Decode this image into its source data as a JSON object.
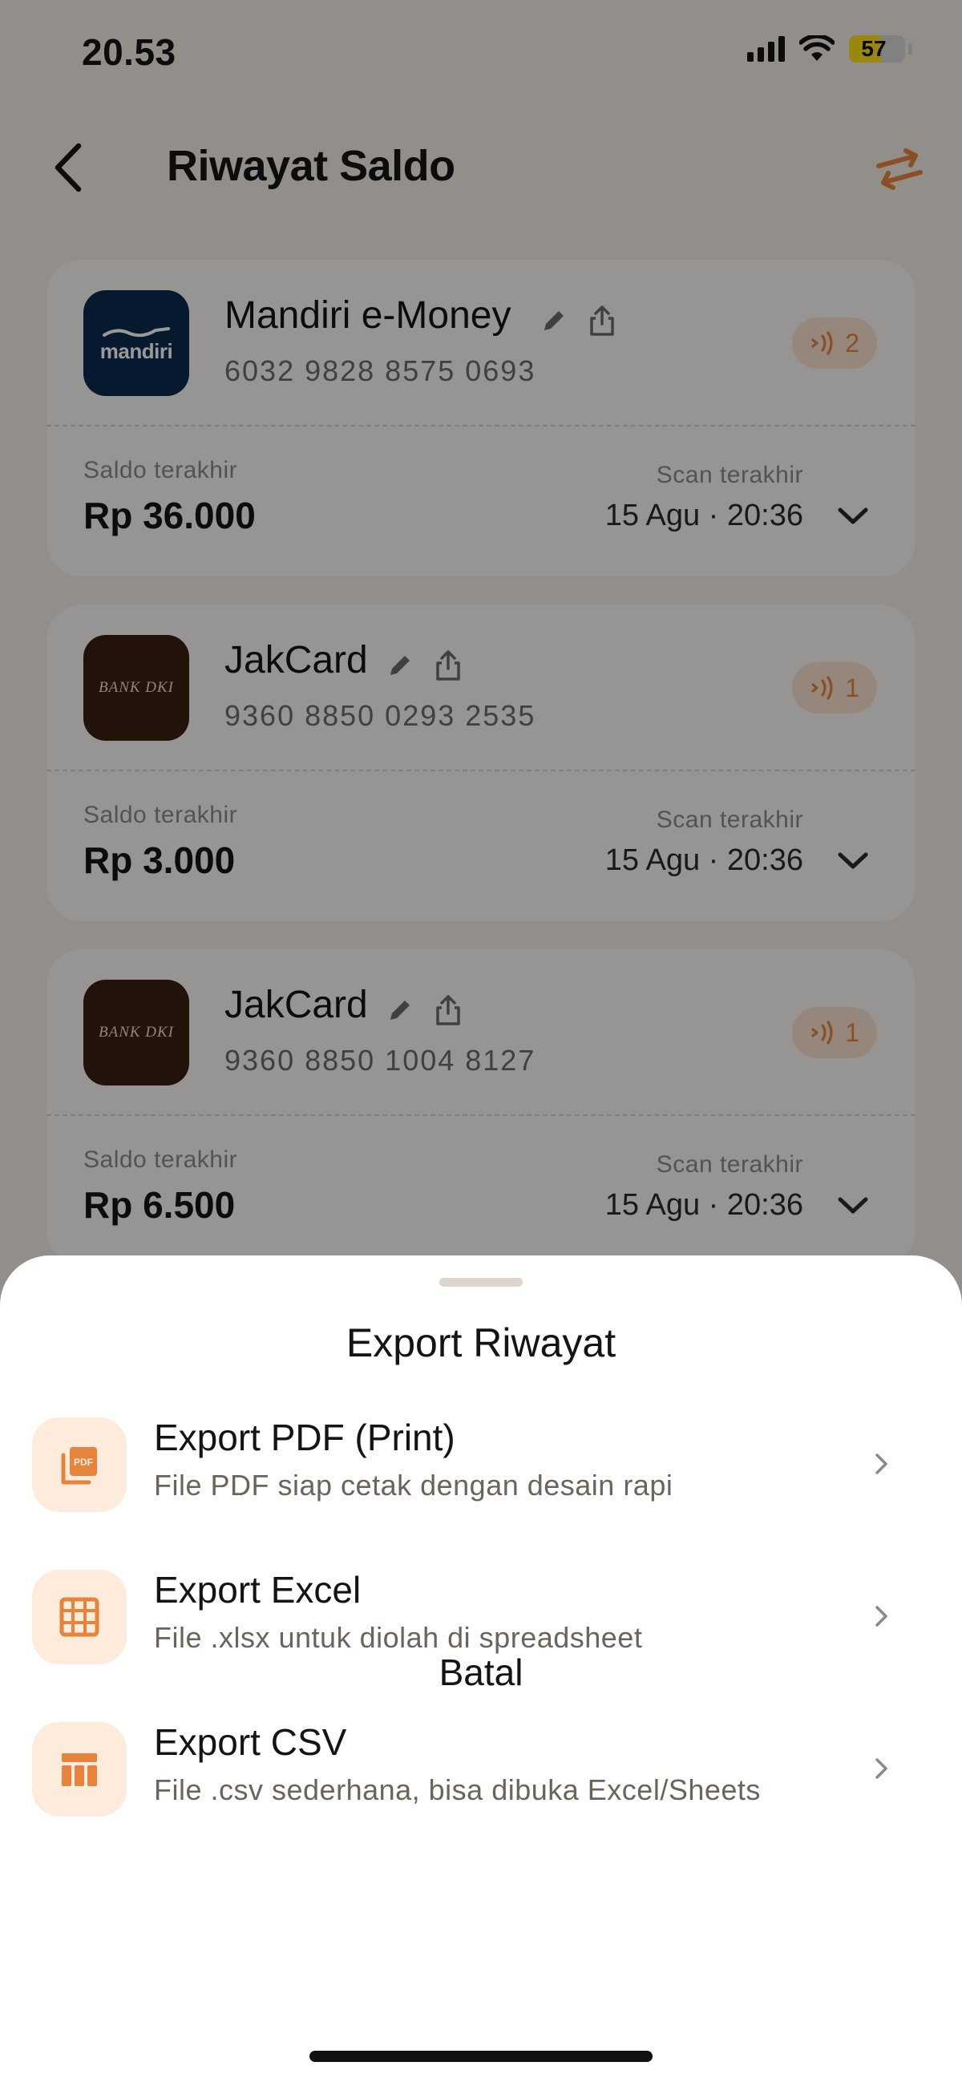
{
  "status_bar": {
    "time": "20.53",
    "battery": "57",
    "battery_level": 0.57,
    "icons": [
      "cellular-signal-icon",
      "wifi-icon",
      "battery-icon"
    ]
  },
  "header": {
    "title": "Riwayat Saldo",
    "back_icon": "chevron-left-icon",
    "action_icon": "swap-arrows-icon"
  },
  "cards": [
    {
      "name": "Mandiri e-Money",
      "number": "6032 9828 8575 0693",
      "logo_text": "mandiri",
      "scan_count": "2",
      "saldo_label": "Saldo terakhir",
      "saldo_value": "Rp 36.000",
      "scan_label": "Scan terakhir",
      "scan_value": "15 Agu · 20:36"
    },
    {
      "name": "JakCard",
      "number": "9360 8850 0293 2535",
      "logo_text": "BANK DKI",
      "scan_count": "1",
      "saldo_label": "Saldo terakhir",
      "saldo_value": "Rp 3.000",
      "scan_label": "Scan terakhir",
      "scan_value": "15 Agu · 20:36"
    },
    {
      "name": "JakCard",
      "number": "9360 8850 1004 8127",
      "logo_text": "BANK DKI",
      "scan_count": "1",
      "saldo_label": "Saldo terakhir",
      "saldo_value": "Rp 6.500",
      "scan_label": "Scan terakhir",
      "scan_value": "15 Agu · 20:36"
    }
  ],
  "sheet": {
    "title": "Export Riwayat",
    "options": [
      {
        "title": "Export PDF (Print)",
        "desc": "File PDF siap cetak dengan desain rapi",
        "icon": "pdf-file-icon"
      },
      {
        "title": "Export Excel",
        "desc": "File .xlsx untuk diolah di spreadsheet",
        "icon": "spreadsheet-grid-icon"
      },
      {
        "title": "Export CSV",
        "desc": "File .csv sederhana, bisa dibuka Excel/Sheets",
        "icon": "table-columns-icon"
      }
    ],
    "cancel": "Batal"
  },
  "colors": {
    "accent": "#e6843d",
    "accent_light": "#fdebdc",
    "background": "#f4efe8",
    "overlay": "rgba(0,0,0,0.40)"
  }
}
